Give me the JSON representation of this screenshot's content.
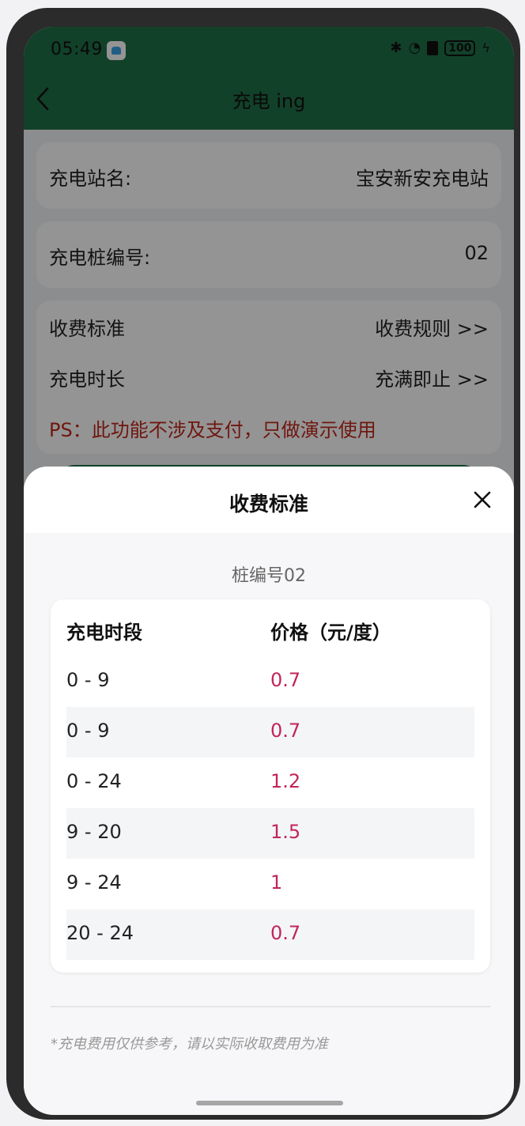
{
  "status_bar": {
    "time": "05:49",
    "battery": "100"
  },
  "header": {
    "title": "充电 ing"
  },
  "station": {
    "label": "充电站名:",
    "value": "宝安新安充电站"
  },
  "pile": {
    "label": "充电桩编号:",
    "value": "02"
  },
  "fees": {
    "standard_label": "收费标准",
    "rule_link": "收费规则 >>",
    "duration_label": "充电时长",
    "duration_value": "充满即止 >>",
    "ps": "PS：此功能不涉及支付，只做演示使用"
  },
  "sheet": {
    "title": "收费标准",
    "pile_no": "桩编号02",
    "columns": [
      "充电时段",
      "价格（元/度）"
    ],
    "rows": [
      {
        "period": "0 - 9",
        "price": "0.7"
      },
      {
        "period": "0 - 9",
        "price": "0.7"
      },
      {
        "period": "0 - 24",
        "price": "1.2"
      },
      {
        "period": "9 - 20",
        "price": "1.5"
      },
      {
        "period": "9 - 24",
        "price": "1"
      },
      {
        "period": "20 - 24",
        "price": "0.7"
      }
    ],
    "note": "*充电费用仅供参考，请以实际收取费用为准"
  },
  "colors": {
    "brand_green": "#1f7047",
    "price": "#c2255c",
    "ps_red": "#c0281c"
  },
  "icons": {
    "back": "chevron-left-icon",
    "close": "close-icon"
  }
}
